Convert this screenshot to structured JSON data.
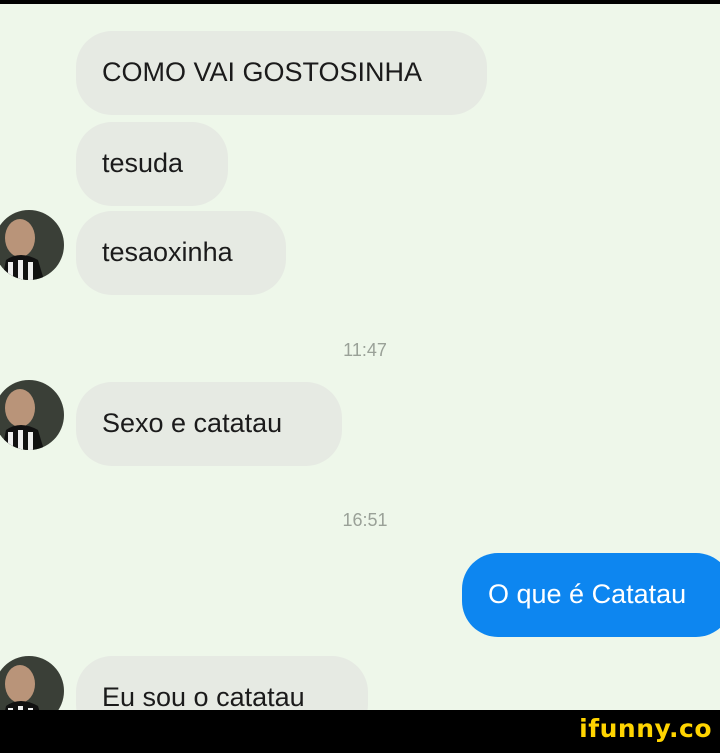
{
  "messages": {
    "m1": "COMO VAI GOSTOSINHA",
    "m2": "tesuda",
    "m3": "tesaoxinha",
    "t1": "11:47",
    "m4": "Sexo e catatau",
    "t2": "16:51",
    "m5": "O que é Catatau",
    "m6": "Eu sou o catatau"
  },
  "colors": {
    "chat_background": "#eef7ea",
    "incoming_bubble": "#e6eae3",
    "outgoing_bubble": "#0d86f0",
    "watermark": "#ffd400"
  },
  "watermark": {
    "text": "ifunny.co"
  }
}
